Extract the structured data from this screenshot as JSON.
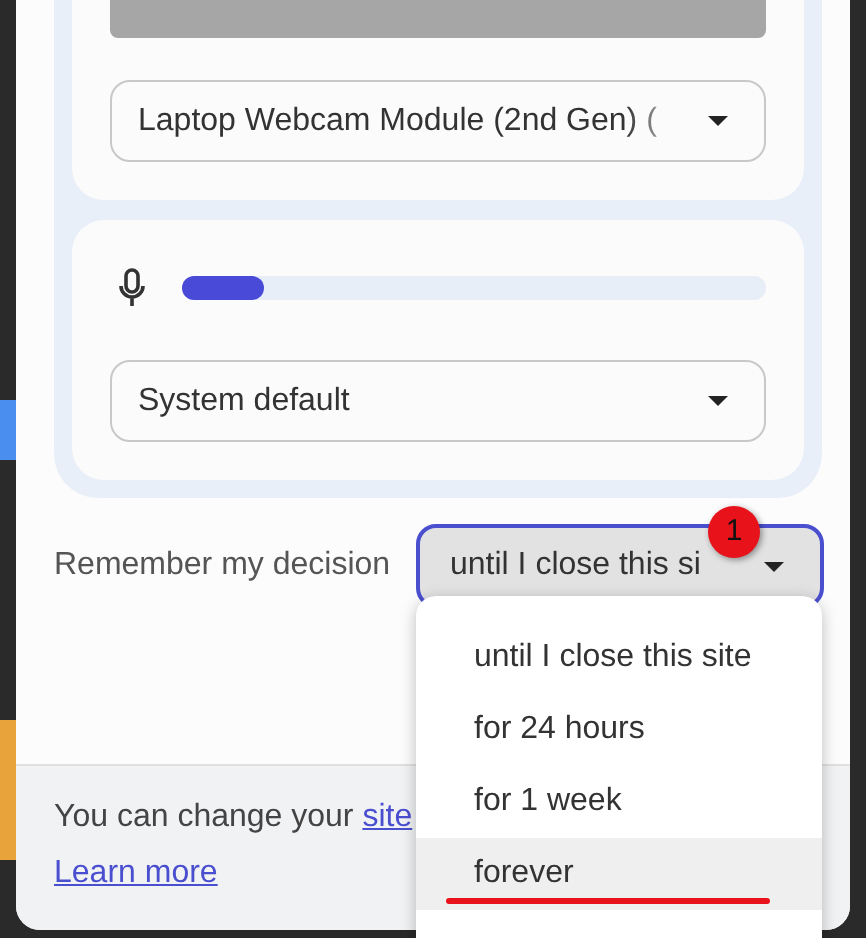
{
  "camera": {
    "device": "Laptop Webcam Module (2nd Gen) ("
  },
  "microphone": {
    "level": 0.14,
    "device": "System default"
  },
  "remember": {
    "label": "Remember my decision",
    "value": "until I close this si",
    "open": true,
    "options": [
      {
        "label": "until I close this site",
        "selected": false
      },
      {
        "label": "for 24 hours",
        "selected": false
      },
      {
        "label": "for 1 week",
        "selected": false
      },
      {
        "label": "forever",
        "selected": true
      }
    ]
  },
  "footer": {
    "text": "You can change your ",
    "link": "site",
    "learn_more": "Learn more"
  },
  "annotation": {
    "badge": "1"
  }
}
